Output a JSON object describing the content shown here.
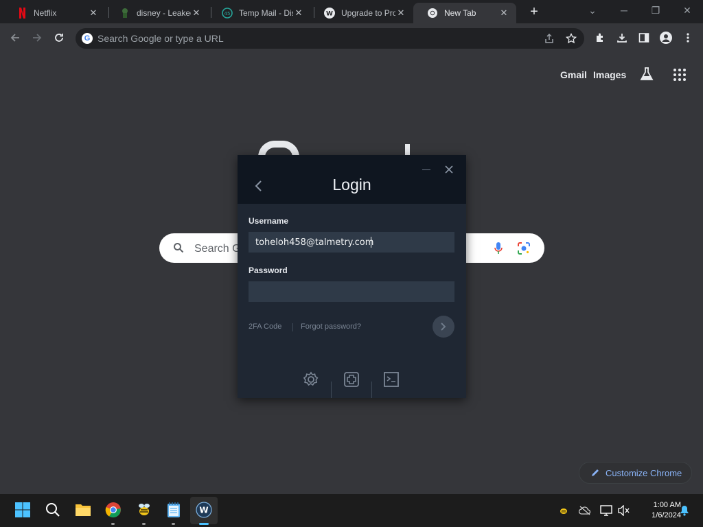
{
  "browser": {
    "tabs": [
      {
        "title": "Netflix",
        "icon": "netflix-icon"
      },
      {
        "title": "disney - Leaked",
        "icon": "leak-site-icon"
      },
      {
        "title": "Temp Mail - Dis",
        "icon": "temp-mail-icon"
      },
      {
        "title": "Upgrade to Pro",
        "icon": "windscribe-icon"
      },
      {
        "title": "New Tab",
        "icon": "chrome-icon",
        "active": true
      }
    ],
    "new_tab_symbol": "+",
    "omnibox_placeholder": "Search Google or type a URL"
  },
  "ntp": {
    "gmail": "Gmail",
    "images": "Images",
    "search_placeholder": "Search Google or type a URL",
    "customize_label": "Customize Chrome"
  },
  "login_popup": {
    "title": "Login",
    "username_label": "Username",
    "username_value": "toheloh458@talmetry.com",
    "password_label": "Password",
    "password_value": "",
    "twofa_label": "2FA Code",
    "forgot_label": "Forgot password?"
  },
  "taskbar": {
    "time": "1:00 AM",
    "date": "1/6/2024"
  },
  "colors": {
    "popup_bg": "#1f2733",
    "popup_header": "#0f1620",
    "field_bg": "#2f3a48",
    "accent_link": "#8ab4f8"
  }
}
